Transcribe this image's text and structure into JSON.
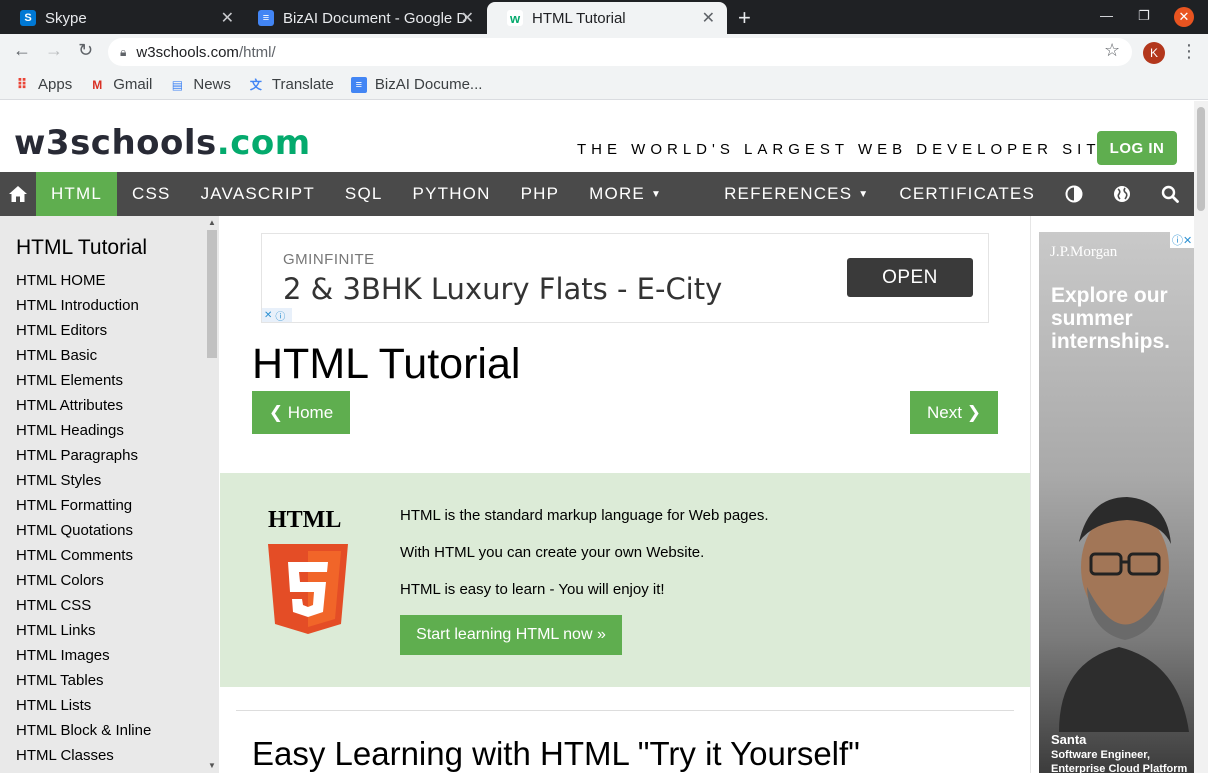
{
  "browser": {
    "tabs": [
      {
        "title": "Skype",
        "fav_color": "#0078d4",
        "fav_glyph": "S"
      },
      {
        "title": "BizAI Document - Google D",
        "fav_color": "#4285f4",
        "fav_glyph": "≡"
      },
      {
        "title": "HTML Tutorial",
        "fav_color": "#04aa6d",
        "fav_glyph": "w"
      }
    ],
    "address": {
      "host": "w3schools.com",
      "path": "/html/"
    },
    "avatar_letter": "K",
    "bookmarks": [
      "Apps",
      "Gmail",
      "News",
      "Translate",
      "BizAI Docume..."
    ]
  },
  "site": {
    "logo_main": "w3schools",
    "logo_tld": ".com",
    "slogan": "THE WORLD'S LARGEST WEB DEVELOPER SITE",
    "login": "LOG IN",
    "nav": [
      "HTML",
      "CSS",
      "JAVASCRIPT",
      "SQL",
      "PYTHON",
      "PHP",
      "MORE",
      "REFERENCES",
      "CERTIFICATES"
    ],
    "accent": "#5fae4f"
  },
  "sidebar": {
    "title": "HTML Tutorial",
    "items": [
      "HTML HOME",
      "HTML Introduction",
      "HTML Editors",
      "HTML Basic",
      "HTML Elements",
      "HTML Attributes",
      "HTML Headings",
      "HTML Paragraphs",
      "HTML Styles",
      "HTML Formatting",
      "HTML Quotations",
      "HTML Comments",
      "HTML Colors",
      "HTML CSS",
      "HTML Links",
      "HTML Images",
      "HTML Tables",
      "HTML Lists",
      "HTML Block & Inline",
      "HTML Classes"
    ]
  },
  "ad_top": {
    "brand": "GMINFINITE",
    "headline": "2 & 3BHK Luxury Flats - E-City",
    "cta": "OPEN"
  },
  "main": {
    "title": "HTML Tutorial",
    "home_btn": "❮ Home",
    "next_btn": "Next ❯",
    "intro_label": "HTML",
    "intro_lines": [
      "HTML is the standard markup language for Web pages.",
      "With HTML you can create your own Website.",
      "HTML is easy to learn - You will enjoy it!"
    ],
    "start_btn": "Start learning HTML now »",
    "section_title": "Easy Learning with HTML \"Try it Yourself\""
  },
  "ad_right": {
    "brand": "J.P.Morgan",
    "headline": "Explore our summer internships.",
    "person_name": "Santa",
    "person_role": "Software Engineer, Enterprise Cloud Platform"
  }
}
